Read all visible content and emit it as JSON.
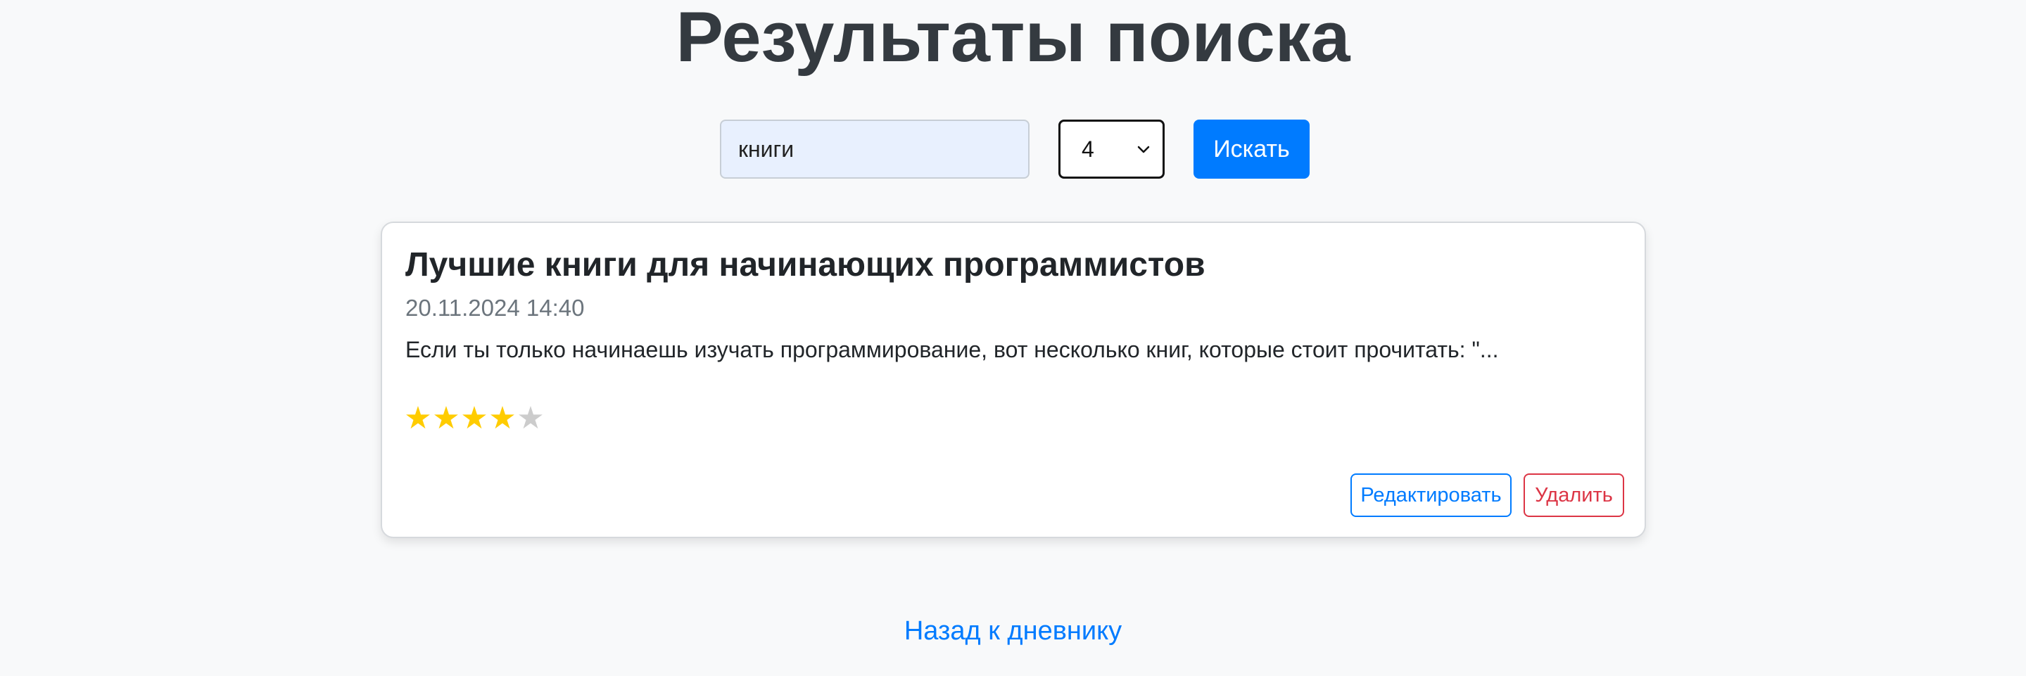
{
  "page": {
    "title": "Результаты поиска"
  },
  "search": {
    "query_value": "книги",
    "rating_selected": "4",
    "submit_label": "Искать"
  },
  "results": [
    {
      "title": "Лучшие книги для начинающих программистов",
      "date": "20.11.2024 14:40",
      "excerpt": "Если ты только начинаешь изучать программирование, вот несколько книг, которые стоит прочитать: \"...",
      "rating": 4,
      "rating_max": 5,
      "star_glyph": "★",
      "edit_label": "Редактировать",
      "delete_label": "Удалить"
    }
  ],
  "footer": {
    "back_link_label": "Назад к дневнику"
  },
  "colors": {
    "accent": "#007bff",
    "danger": "#dc3545",
    "star_filled": "#ffcc00",
    "star_empty": "#cccccc",
    "title_text": "#343a40",
    "background": "#f8f9fa"
  },
  "icons": {
    "select_arrow": "chevron-down-icon",
    "rating": "star-icon"
  }
}
